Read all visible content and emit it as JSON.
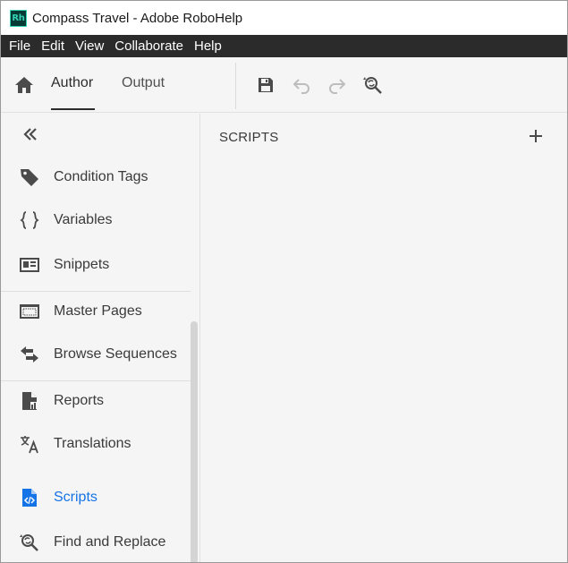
{
  "window": {
    "app_icon": "Rh",
    "title": "Compass Travel - Adobe RoboHelp"
  },
  "menu": {
    "items": [
      "File",
      "Edit",
      "View",
      "Collaborate",
      "Help"
    ]
  },
  "toolbar": {
    "home_icon": "home-icon",
    "tabs": [
      {
        "label": "Author",
        "active": true
      },
      {
        "label": "Output",
        "active": false
      }
    ],
    "actions": [
      "save-icon",
      "undo-icon",
      "redo-icon",
      "find-replace-icon"
    ]
  },
  "sidebar": {
    "collapse_icon": "double-chevron-left-icon",
    "items": [
      {
        "label": "Condition Tags",
        "icon": "tag-icon"
      },
      {
        "label": "Variables",
        "icon": "braces-icon"
      },
      {
        "label": "Snippets",
        "icon": "snippet-icon"
      },
      {
        "label": "Master Pages",
        "icon": "master-page-icon"
      },
      {
        "label": "Browse Sequences",
        "icon": "browse-sequence-icon"
      },
      {
        "label": "Reports",
        "icon": "reports-icon"
      },
      {
        "label": "Translations",
        "icon": "translate-icon"
      },
      {
        "label": "Scripts",
        "icon": "script-file-icon",
        "active": true
      },
      {
        "label": "Find and Replace",
        "icon": "find-replace-icon"
      }
    ]
  },
  "main": {
    "panel_title": "SCRIPTS",
    "add_icon": "plus-icon"
  },
  "colors": {
    "accent": "#1473e6",
    "menubar_bg": "#2b2b2b",
    "panel_bg": "#f5f5f5",
    "logo_bg": "#073a34",
    "logo_fg": "#34d1b5"
  }
}
